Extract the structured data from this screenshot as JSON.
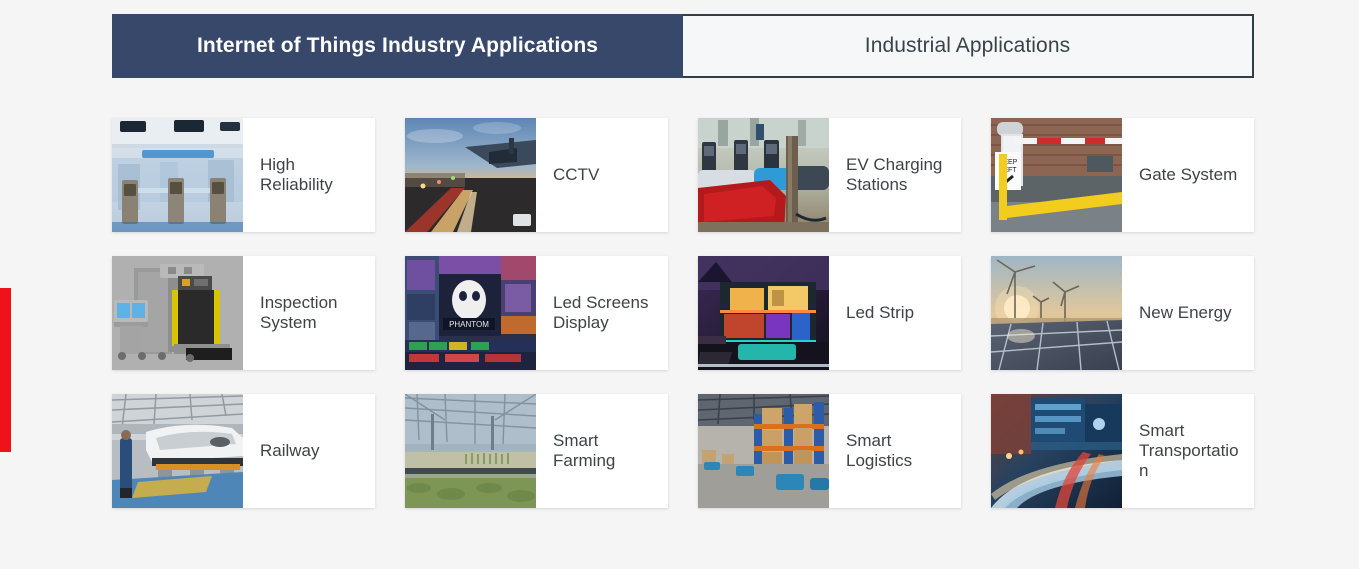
{
  "page": {
    "background_color": "#f5f5f6",
    "accent_red": "#ee1319",
    "tab_active_color": "#37486a",
    "text_color": "#3f4348"
  },
  "tabs": [
    {
      "label": "Internet of Things Industry Applications",
      "active": true
    },
    {
      "label": "Industrial Applications",
      "active": false
    }
  ],
  "cards": [
    {
      "label": "High Reliability",
      "image": "subway-turnstiles-photo"
    },
    {
      "label": "CCTV",
      "image": "city-street-dusk-cctv-camera-photo"
    },
    {
      "label": "EV Charging Stations",
      "image": "ev-charging-station-cars-photo"
    },
    {
      "label": "Gate System",
      "image": "parking-barrier-gate-keep-left-sign-photo"
    },
    {
      "label": "Inspection System",
      "image": "xray-baggage-scanner-photo"
    },
    {
      "label": "Led Screens Display",
      "image": "times-square-led-billboards-photo"
    },
    {
      "label": "Led Strip",
      "image": "modern-house-night-led-lighting-photo"
    },
    {
      "label": "New Energy",
      "image": "solar-panels-wind-turbines-sunset-photo"
    },
    {
      "label": "Railway",
      "image": "high-speed-train-factory-photo"
    },
    {
      "label": "Smart Farming",
      "image": "greenhouse-crops-photo"
    },
    {
      "label": "Smart Logistics",
      "image": "warehouse-agv-robots-racks-photo"
    },
    {
      "label": "Smart Transportation",
      "image": "city-traffic-light-trails-night-photo"
    }
  ]
}
